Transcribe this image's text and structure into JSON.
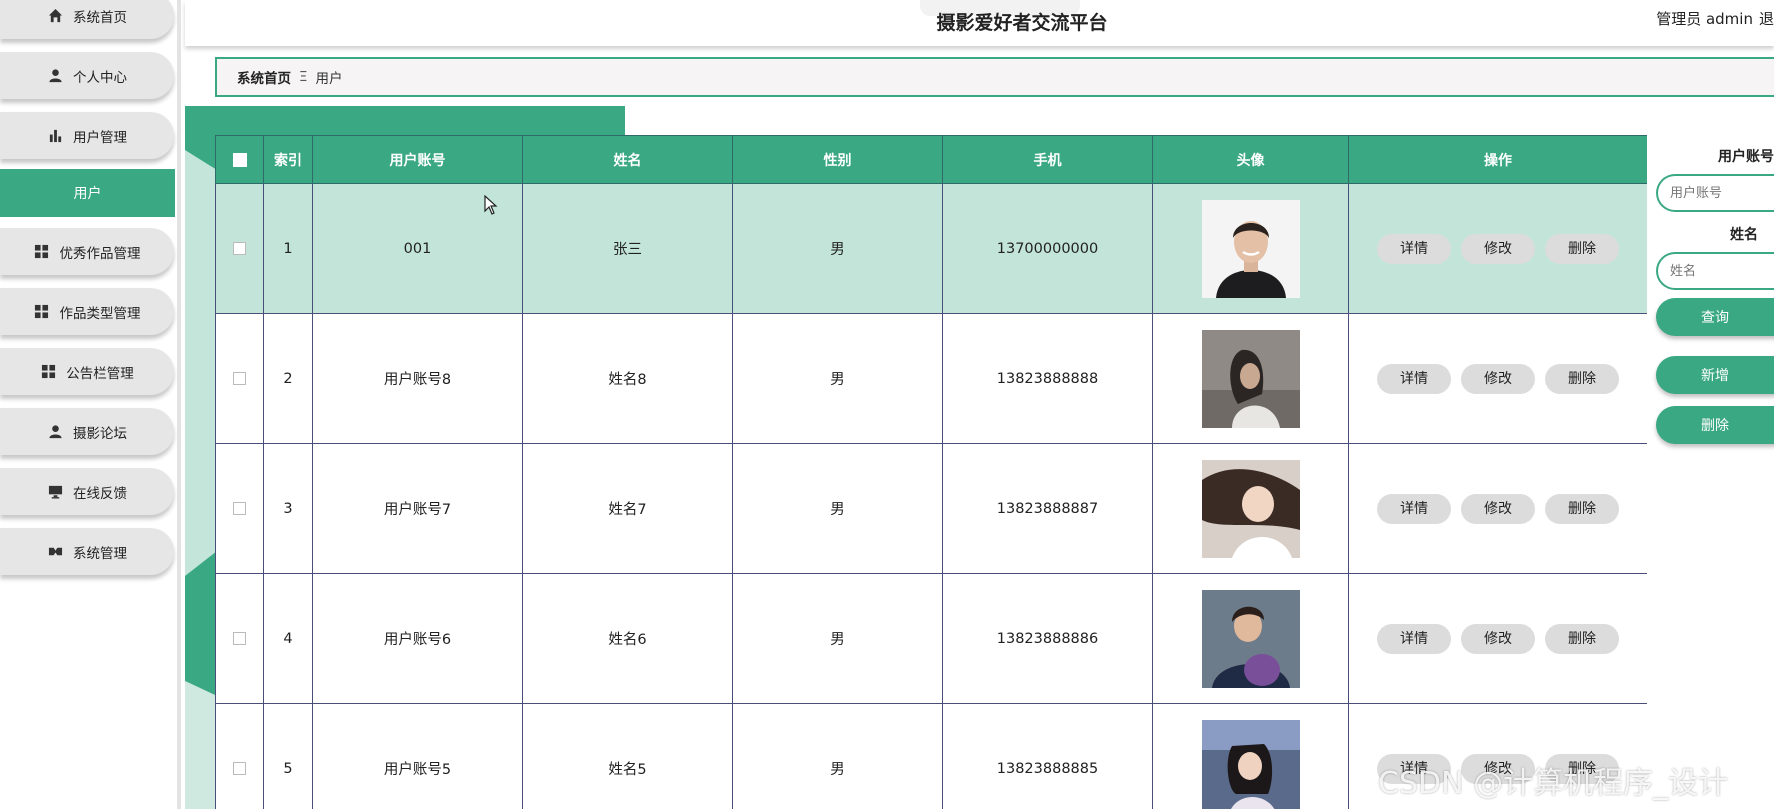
{
  "header": {
    "site_title": "摄影爱好者交流平台",
    "admin_label": "管理员 admin",
    "logout_label": "退"
  },
  "sidebar": {
    "items": [
      {
        "label": "系统首页",
        "icon": "home-icon"
      },
      {
        "label": "个人中心",
        "icon": "user-icon"
      },
      {
        "label": "用户管理",
        "icon": "bar-chart-icon"
      },
      {
        "label": "优秀作品管理",
        "icon": "grid-icon"
      },
      {
        "label": "作品类型管理",
        "icon": "grid-icon"
      },
      {
        "label": "公告栏管理",
        "icon": "grid-icon"
      },
      {
        "label": "摄影论坛",
        "icon": "user-icon"
      },
      {
        "label": "在线反馈",
        "icon": "monitor-icon"
      },
      {
        "label": "系统管理",
        "icon": "settings-icon"
      }
    ],
    "active_sub": "用户"
  },
  "breadcrumb": {
    "home": "系统首页",
    "separator": "Ξ",
    "current": "用户"
  },
  "table": {
    "columns": [
      "索引",
      "用户账号",
      "姓名",
      "性别",
      "手机",
      "头像",
      "操作"
    ],
    "rows": [
      {
        "index": "1",
        "account": "001",
        "name": "张三",
        "gender": "男",
        "phone": "13700000000",
        "avatar": "avatar-man-smiling"
      },
      {
        "index": "2",
        "account": "用户账号8",
        "name": "姓名8",
        "gender": "男",
        "phone": "13823888888",
        "avatar": "avatar-woman-grey"
      },
      {
        "index": "3",
        "account": "用户账号7",
        "name": "姓名7",
        "gender": "男",
        "phone": "13823888887",
        "avatar": "avatar-woman-lying"
      },
      {
        "index": "4",
        "account": "用户账号6",
        "name": "姓名6",
        "gender": "男",
        "phone": "13823888886",
        "avatar": "avatar-boy-purple"
      },
      {
        "index": "5",
        "account": "用户账号5",
        "name": "姓名5",
        "gender": "男",
        "phone": "13823888885",
        "avatar": "avatar-girl-selfie"
      }
    ],
    "actions": {
      "detail": "详情",
      "edit": "修改",
      "delete": "删除"
    }
  },
  "search_panel": {
    "account_label": "用户账号",
    "account_placeholder": "用户账号",
    "name_label": "姓名",
    "name_placeholder": "姓名",
    "query_button": "查询",
    "add_button": "新增",
    "delete_button": "删除"
  },
  "watermark": "CSDN @计算机程序_设计",
  "colors": {
    "accent": "#3aa883",
    "selected_row": "#c3e5d9"
  }
}
